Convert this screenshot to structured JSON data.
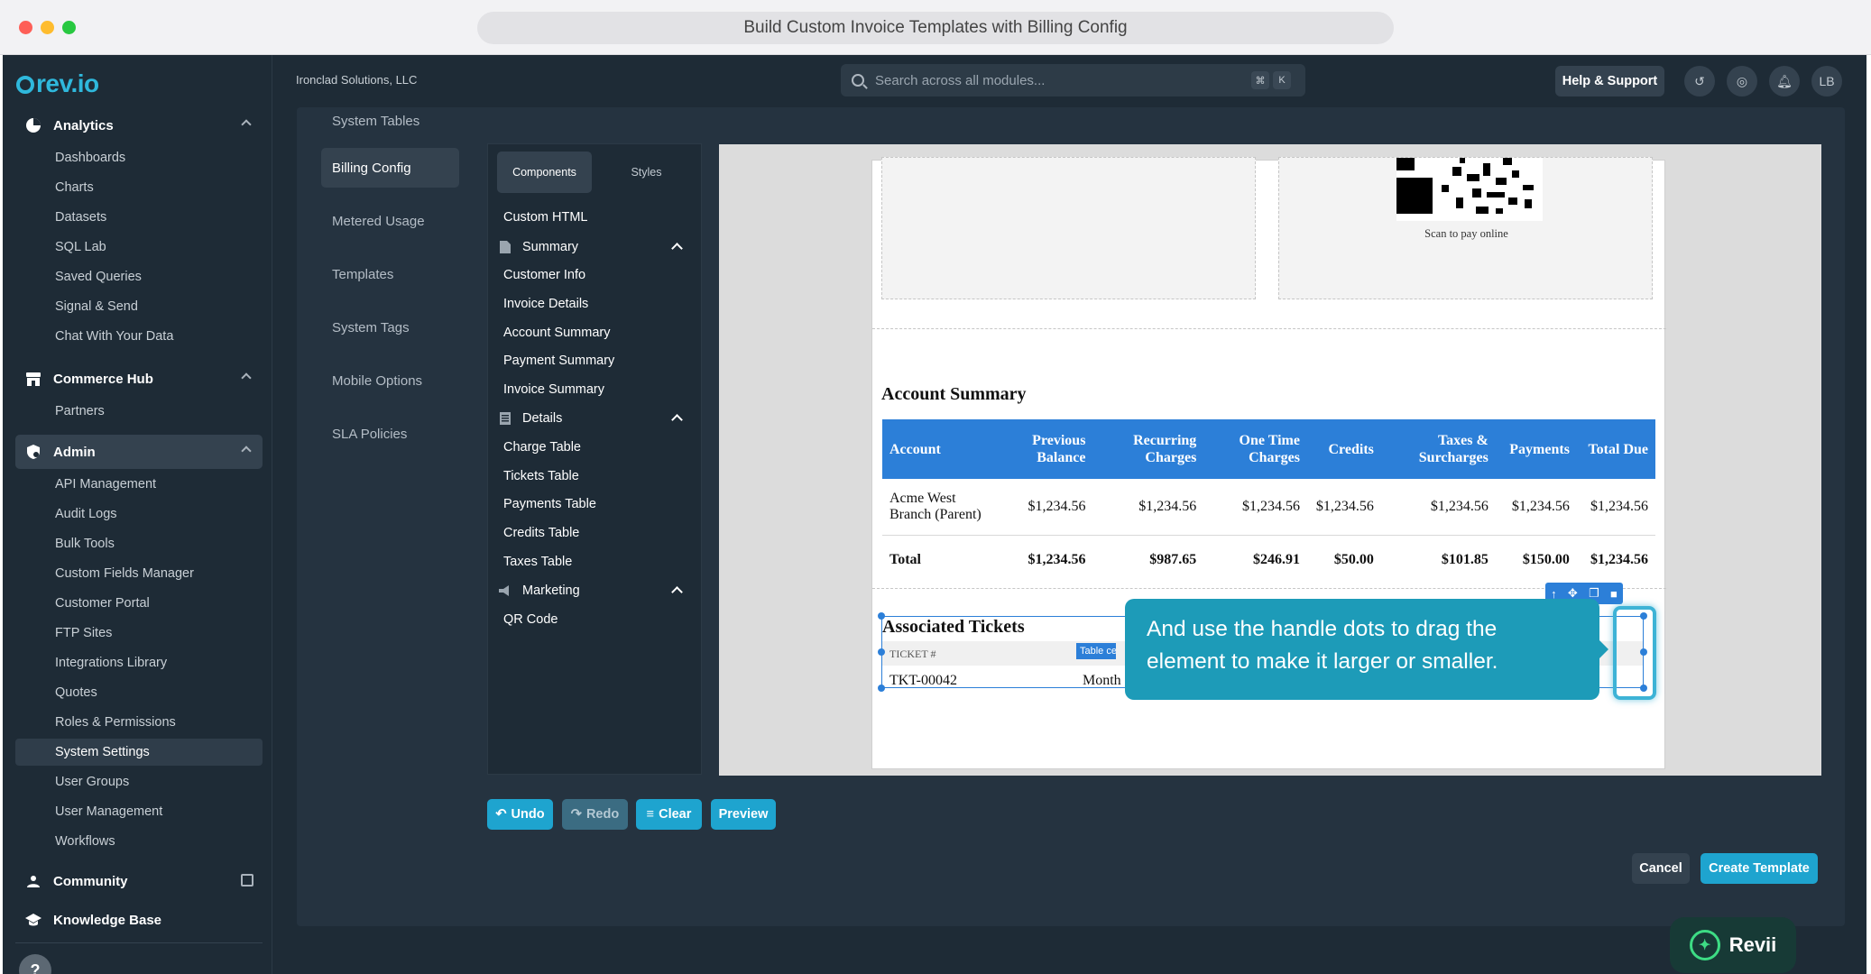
{
  "window": {
    "title": "Build Custom Invoice Templates with Billing Config"
  },
  "brand": {
    "logo_text": "rev.io",
    "accent": "#2fb8dc"
  },
  "topbar": {
    "company": "Ironclad Solutions, LLC",
    "search_placeholder": "Search across all modules...",
    "kbd_cmd": "⌘",
    "kbd_k": "K",
    "help_label": "Help & Support",
    "avatar_initials": "LB"
  },
  "sidebar": {
    "analytics": {
      "label": "Analytics",
      "items": [
        "Dashboards",
        "Charts",
        "Datasets",
        "SQL Lab",
        "Saved Queries",
        "Signal & Send",
        "Chat With Your Data"
      ]
    },
    "commerce": {
      "label": "Commerce Hub",
      "items": [
        "Partners"
      ]
    },
    "admin": {
      "label": "Admin",
      "items": [
        "API Management",
        "Audit Logs",
        "Bulk Tools",
        "Custom Fields Manager",
        "Customer Portal",
        "FTP Sites",
        "Integrations Library",
        "Quotes",
        "Roles & Permissions",
        "System Settings",
        "User Groups",
        "User Management",
        "Workflows"
      ],
      "active": "System Settings"
    },
    "community": "Community",
    "knowledge": "Knowledge Base",
    "help_glyph": "?"
  },
  "settings_nav": {
    "items": [
      "System Tables",
      "Billing Config",
      "Metered Usage",
      "Templates",
      "System Tags",
      "Mobile Options",
      "SLA Policies"
    ],
    "active": "Billing Config"
  },
  "components_panel": {
    "tab_components": "Components",
    "tab_styles": "Styles",
    "custom_html": "Custom HTML",
    "summary_group": "Summary",
    "summary_items": [
      "Customer Info",
      "Invoice Details",
      "Account Summary",
      "Payment Summary",
      "Invoice Summary"
    ],
    "details_group": "Details",
    "details_items": [
      "Charge Table",
      "Tickets Table",
      "Payments Table",
      "Credits Table",
      "Taxes Table"
    ],
    "marketing_group": "Marketing",
    "marketing_items": [
      "QR Code"
    ]
  },
  "invoice": {
    "scan_text": "Scan to pay online",
    "account_summary_title": "Account Summary",
    "headers": [
      "Account",
      "Previous Balance",
      "Recurring Charges",
      "One Time Charges",
      "Credits",
      "Taxes & Surcharges",
      "Payments",
      "Total Due"
    ],
    "rows": [
      [
        "Acme West Branch (Parent)",
        "$1,234.56",
        "$1,234.56",
        "$1,234.56",
        "$1,234.56",
        "$1,234.56",
        "$1,234.56",
        "$1,234.56"
      ]
    ],
    "total_row": [
      "Total",
      "$1,234.56",
      "$987.65",
      "$246.91",
      "$50.00",
      "$101.85",
      "$150.00",
      "$1,234.56"
    ],
    "tickets_title": "Associated Tickets",
    "tickets_header": "TICKET #",
    "table_cell_tag": "Table ce",
    "ticket_id": "TKT-00042",
    "ticket_partial": "Month"
  },
  "toolbar": {
    "undo": "Undo",
    "redo": "Redo",
    "clear": "Clear",
    "preview": "Preview"
  },
  "actions": {
    "cancel": "Cancel",
    "create": "Create Template"
  },
  "tooltip": {
    "text": "And use the handle dots to drag the element to make it larger or smaller."
  },
  "revii": {
    "label": "Revii"
  }
}
